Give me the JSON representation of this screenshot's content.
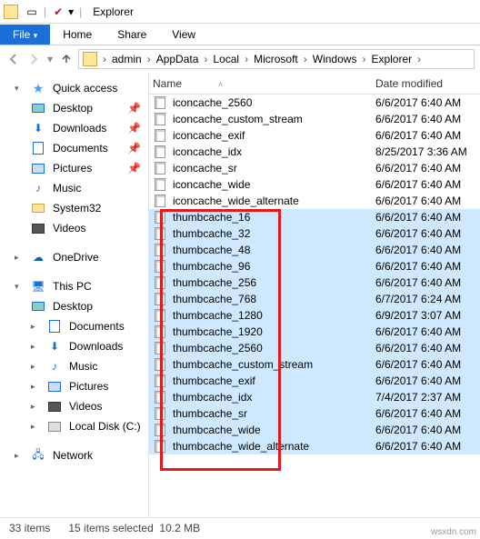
{
  "window": {
    "title": "Explorer"
  },
  "tabs": {
    "file": "File",
    "home": "Home",
    "share": "Share",
    "view": "View"
  },
  "breadcrumb": [
    "admin",
    "AppData",
    "Local",
    "Microsoft",
    "Windows",
    "Explorer"
  ],
  "columns": {
    "name": "Name",
    "date": "Date modified"
  },
  "sidebar": {
    "quick_access": "Quick access",
    "desktop": "Desktop",
    "downloads": "Downloads",
    "documents": "Documents",
    "pictures": "Pictures",
    "music": "Music",
    "system32": "System32",
    "videos": "Videos",
    "onedrive": "OneDrive",
    "this_pc": "This PC",
    "pc_desktop": "Desktop",
    "pc_documents": "Documents",
    "pc_downloads": "Downloads",
    "pc_music": "Music",
    "pc_pictures": "Pictures",
    "pc_videos": "Videos",
    "local_disk": "Local Disk (C:)",
    "network": "Network"
  },
  "files": [
    {
      "name": "iconcache_2560",
      "date": "6/6/2017 6:40 AM",
      "sel": false
    },
    {
      "name": "iconcache_custom_stream",
      "date": "6/6/2017 6:40 AM",
      "sel": false
    },
    {
      "name": "iconcache_exif",
      "date": "6/6/2017 6:40 AM",
      "sel": false
    },
    {
      "name": "iconcache_idx",
      "date": "8/25/2017 3:36 AM",
      "sel": false
    },
    {
      "name": "iconcache_sr",
      "date": "6/6/2017 6:40 AM",
      "sel": false
    },
    {
      "name": "iconcache_wide",
      "date": "6/6/2017 6:40 AM",
      "sel": false
    },
    {
      "name": "iconcache_wide_alternate",
      "date": "6/6/2017 6:40 AM",
      "sel": false
    },
    {
      "name": "thumbcache_16",
      "date": "6/6/2017 6:40 AM",
      "sel": true
    },
    {
      "name": "thumbcache_32",
      "date": "6/6/2017 6:40 AM",
      "sel": true
    },
    {
      "name": "thumbcache_48",
      "date": "6/6/2017 6:40 AM",
      "sel": true
    },
    {
      "name": "thumbcache_96",
      "date": "6/6/2017 6:40 AM",
      "sel": true
    },
    {
      "name": "thumbcache_256",
      "date": "6/6/2017 6:40 AM",
      "sel": true
    },
    {
      "name": "thumbcache_768",
      "date": "6/7/2017 6:24 AM",
      "sel": true
    },
    {
      "name": "thumbcache_1280",
      "date": "6/9/2017 3:07 AM",
      "sel": true
    },
    {
      "name": "thumbcache_1920",
      "date": "6/6/2017 6:40 AM",
      "sel": true
    },
    {
      "name": "thumbcache_2560",
      "date": "6/6/2017 6:40 AM",
      "sel": true
    },
    {
      "name": "thumbcache_custom_stream",
      "date": "6/6/2017 6:40 AM",
      "sel": true
    },
    {
      "name": "thumbcache_exif",
      "date": "6/6/2017 6:40 AM",
      "sel": true
    },
    {
      "name": "thumbcache_idx",
      "date": "7/4/2017 2:37 AM",
      "sel": true
    },
    {
      "name": "thumbcache_sr",
      "date": "6/6/2017 6:40 AM",
      "sel": true
    },
    {
      "name": "thumbcache_wide",
      "date": "6/6/2017 6:40 AM",
      "sel": true
    },
    {
      "name": "thumbcache_wide_alternate",
      "date": "6/6/2017 6:40 AM",
      "sel": true
    }
  ],
  "status": {
    "items": "33 items",
    "selected": "15 items selected",
    "size": "10.2 MB"
  },
  "watermark": "wsxdn.com"
}
